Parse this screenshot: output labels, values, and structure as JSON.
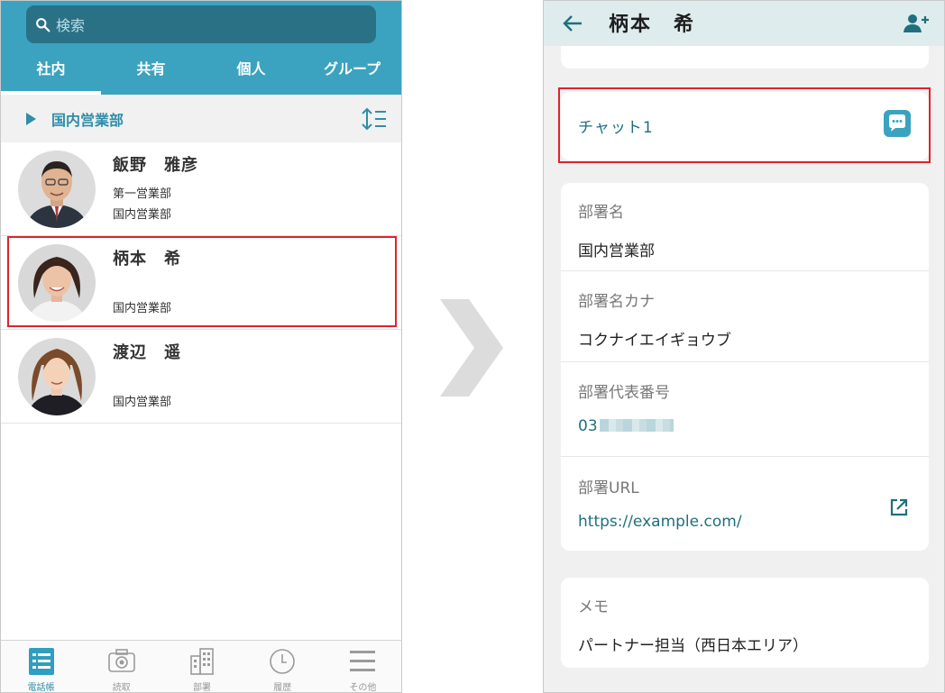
{
  "left": {
    "search": {
      "placeholder": "検索"
    },
    "tabs": [
      {
        "label": "社内",
        "active": true
      },
      {
        "label": "共有",
        "active": false
      },
      {
        "label": "個人",
        "active": false
      },
      {
        "label": "グループ",
        "active": false
      }
    ],
    "group": {
      "label": "国内営業部"
    },
    "contacts": [
      {
        "name": "飯野　雅彦",
        "dept1": "第一営業部",
        "dept2": "国内営業部"
      },
      {
        "name": "柄本　希",
        "dept1": "",
        "dept2": "国内営業部"
      },
      {
        "name": "渡辺　遥",
        "dept1": "",
        "dept2": "国内営業部"
      }
    ],
    "nav": [
      {
        "label": "電話帳",
        "icon": "phonebook-icon",
        "active": true
      },
      {
        "label": "読取",
        "icon": "camera-icon",
        "active": false
      },
      {
        "label": "部署",
        "icon": "building-icon",
        "active": false
      },
      {
        "label": "履歴",
        "icon": "clock-icon",
        "active": false
      },
      {
        "label": "その他",
        "icon": "menu-icon",
        "active": false
      }
    ]
  },
  "right": {
    "title": "柄本　希",
    "chat": {
      "label": "チャット1"
    },
    "fields": [
      {
        "label": "部署名",
        "value": "国内営業部"
      },
      {
        "label": "部署名カナ",
        "value": "コクナイエイギョウブ"
      },
      {
        "label": "部署代表番号",
        "value": "03"
      },
      {
        "label": "部署URL",
        "value": "https://example.com/"
      }
    ],
    "memo": {
      "label": "メモ",
      "value": "パートナー担当（西日本エリア）"
    }
  },
  "colors": {
    "accent": "#3ba3bf",
    "link": "#1f6f7f",
    "highlight": "#e0222e"
  }
}
